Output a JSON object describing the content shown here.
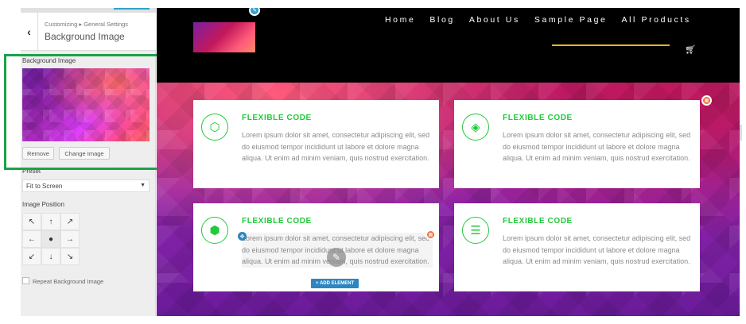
{
  "sidebar": {
    "breadcrumb": "Customizing ▸ General Settings",
    "title": "Background Image",
    "background_label": "Background Image",
    "remove_label": "Remove",
    "change_label": "Change Image",
    "preset_label": "Preset",
    "preset_value": "Fit to Screen",
    "position_label": "Image Position",
    "position_grid": [
      "↖",
      "↑",
      "↗",
      "←",
      "●",
      "→",
      "↙",
      "↓",
      "↘"
    ],
    "repeat_label": "Repeat Background Image",
    "highlight_color": "#1aa34a"
  },
  "site": {
    "nav_links": [
      "Home",
      "Blog",
      "About Us",
      "Sample Page",
      "All Products"
    ],
    "accent_color": "#e6b325",
    "cards": [
      {
        "icon": "cube-hex-icon",
        "glyph": "⬡",
        "title": "FLEXIBLE CODE",
        "text": "Lorem ipsum dolor sit amet, consectetur adipiscing elit, sed do eiusmod tempor incididunt ut labore et dolore magna aliqua. Ut enim ad minim veniam, quis nostrud exercitation."
      },
      {
        "icon": "codepen-icon",
        "glyph": "◈",
        "title": "FLEXIBLE CODE",
        "text": "Lorem ipsum dolor sit amet, consectetur adipiscing elit, sed do eiusmod tempor incididunt ut labore et dolore magna aliqua. Ut enim ad minim veniam, quis nostrud exercitation."
      },
      {
        "icon": "cube-icon",
        "glyph": "⬢",
        "title": "FLEXIBLE CODE",
        "text": "Lorem ipsum dolor sit amet, consectetur adipiscing elit, sed do eiusmod tempor incididunt ut labore et dolore magna aliqua. Ut enim ad minim veniam, quis nostrud exercitation."
      },
      {
        "icon": "database-icon",
        "glyph": "☰",
        "title": "FLEXIBLE CODE",
        "text": "Lorem ipsum dolor sit amet, consectetur adipiscing elit, sed do eiusmod tempor incididunt ut labore et dolore magna aliqua. Ut enim ad minim veniam, quis nostrud exercitation."
      }
    ],
    "add_element_label": "+ ADD ELEMENT",
    "brand_green": "#22c93a"
  }
}
